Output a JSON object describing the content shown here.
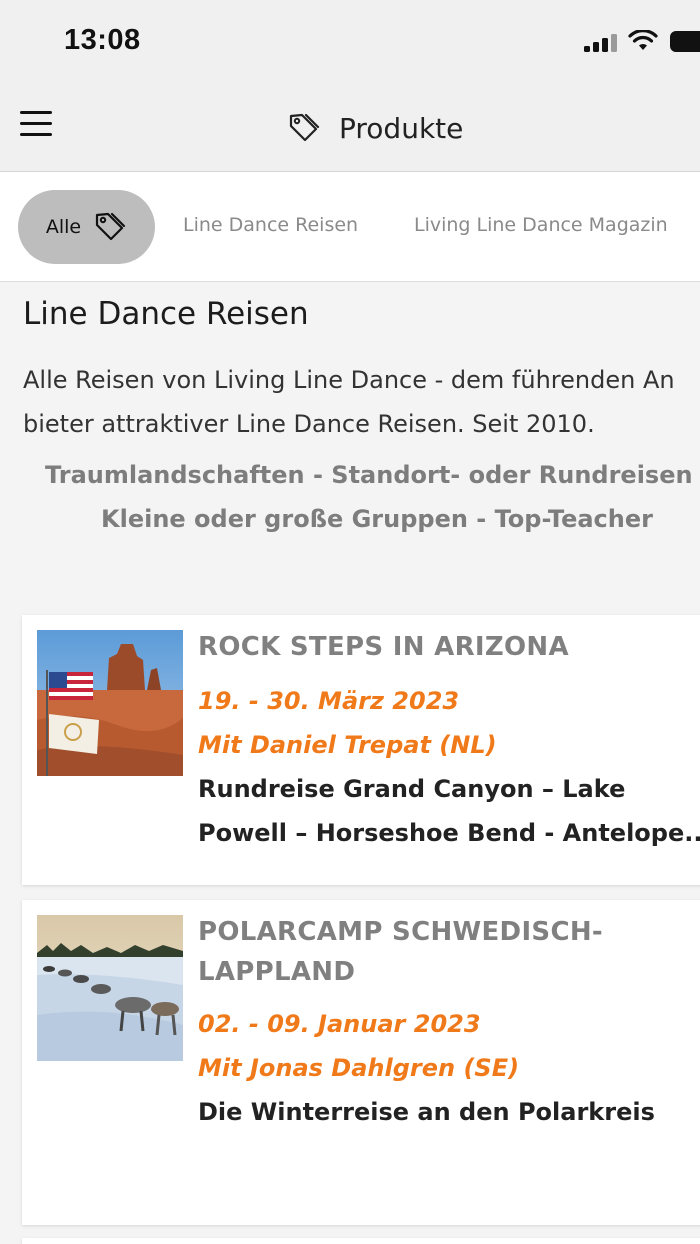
{
  "status": {
    "time": "13:08"
  },
  "nav": {
    "title": "Produkte",
    "menu_icon": "hamburger-menu-icon",
    "title_icon": "tag-icon"
  },
  "filters": [
    {
      "label": "Alle",
      "active": true,
      "icon": "tag-icon"
    },
    {
      "label": "Line Dance Reisen",
      "active": false
    },
    {
      "label": "Living Line Dance Magazin",
      "active": false
    }
  ],
  "section": {
    "title": "Line Dance Reisen",
    "desc_line1": "Alle Reisen von Living Line Dance - dem führenden An",
    "desc_line2": "bieter attraktiver Line Dance Reisen. Seit 2010.",
    "tagline1": "Traumlandschaften - Standort- oder Rundreisen",
    "tagline2": "Kleine oder große Gruppen - Top-Teacher"
  },
  "products": [
    {
      "title_line1": "ROCK STEPS IN ARIZONA",
      "title_line2": "",
      "date": "19. - 30. März 2023",
      "host": "Mit Daniel Trepat (NL)",
      "desc_line1": "Rundreise Grand Canyon – Lake",
      "desc_line2": "Powell – Horseshoe Bend - Antelope..."
    },
    {
      "title_line1": "POLARCAMP SCHWEDISCH-",
      "title_line2": "LAPPLAND",
      "date": "02. - 09. Januar 2023",
      "host": "Mit Jonas Dahlgren (SE)",
      "desc_line1": "Die Winterreise an den Polarkreis",
      "desc_line2": ""
    }
  ],
  "colors": {
    "accent": "#f07a1a",
    "title_gray": "#808080",
    "pill_active": "#bdbdbd"
  }
}
